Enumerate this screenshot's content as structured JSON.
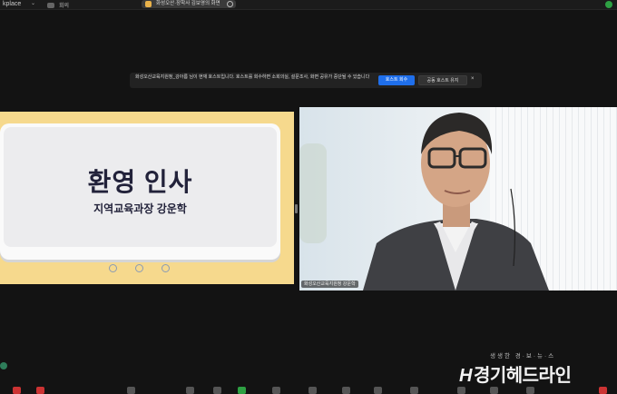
{
  "topbar": {
    "app_label": "kplace",
    "chevron": "⌄",
    "meeting_label": "회의",
    "share_title": "화성오산·장학사 김보영의 화면",
    "status_icon": "check-shield-icon"
  },
  "notice": {
    "message": "화성오산교육지원청_강아름 님이 현재 호스트입니다. 호스트를 회수하면 소회의실, 설문조사, 화면 공유가 중단될 수 있습니다",
    "reclaim_button": "호스트 회수",
    "keep_button": "공동 호스트 유지",
    "close": "×"
  },
  "slide": {
    "title": "환영 인사",
    "subtitle": "지역교육과장 강운학"
  },
  "camera": {
    "name_label": "화성오산교육지원청 강운학"
  },
  "brand": {
    "slogan": "생생한 경·보·뉴·스",
    "name": "경기헤드라인",
    "mark": "H"
  },
  "colors": {
    "slide_frame": "#f6d98d",
    "primary_button": "#1f6feb",
    "background": "#131313"
  }
}
